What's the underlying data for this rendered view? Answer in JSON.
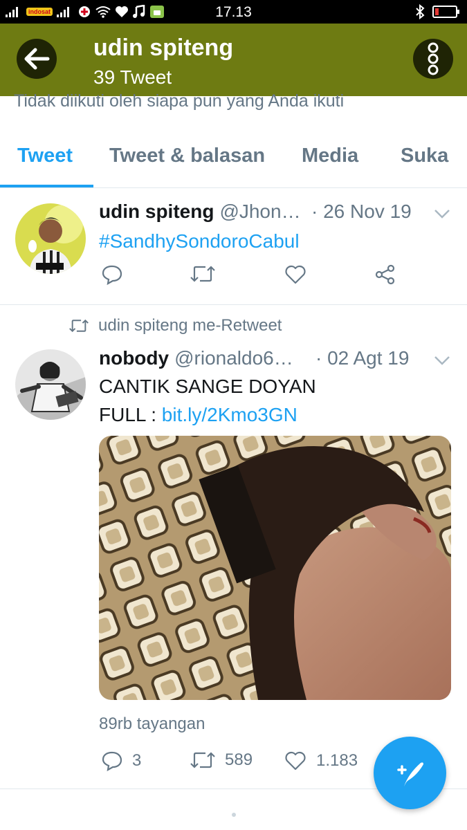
{
  "status_bar": {
    "time": "17.13",
    "carrier": "indosat"
  },
  "header": {
    "name": "udin spiteng",
    "tweet_count": "39 Tweet"
  },
  "follow_info": "Tidak diikuti oleh siapa pun yang Anda ikuti",
  "tabs": [
    {
      "label": "Tweet",
      "active": true
    },
    {
      "label": "Tweet & balasan",
      "active": false
    },
    {
      "label": "Media",
      "active": false
    },
    {
      "label": "Suka",
      "active": false
    }
  ],
  "tweets": [
    {
      "name": "udin spiteng",
      "handle": "@Jhon…",
      "date": "· 26 Nov 19",
      "text": "#SandhySondoroCabul"
    },
    {
      "retweet_label": "udin spiteng me-Retweet",
      "name": "nobody",
      "handle": "@rionaldo6…",
      "date": "· 02 Agt 19",
      "text_line1": "CANTIK SANGE DOYAN",
      "text_line2_prefix": "FULL : ",
      "link": "bit.ly/2Kmo3GN",
      "views": "89rb tayangan",
      "reply_count": "3",
      "retweet_count": "589",
      "like_count": "1.183"
    }
  ],
  "colors": {
    "accent": "#1da1f2",
    "app_bar": "#6e7b12",
    "secondary_text": "#657786"
  },
  "icons": [
    "back-arrow-icon",
    "more-vertical-icon",
    "reply-icon",
    "retweet-icon",
    "like-icon",
    "share-icon",
    "chevron-down-icon",
    "compose-tweet-icon"
  ]
}
